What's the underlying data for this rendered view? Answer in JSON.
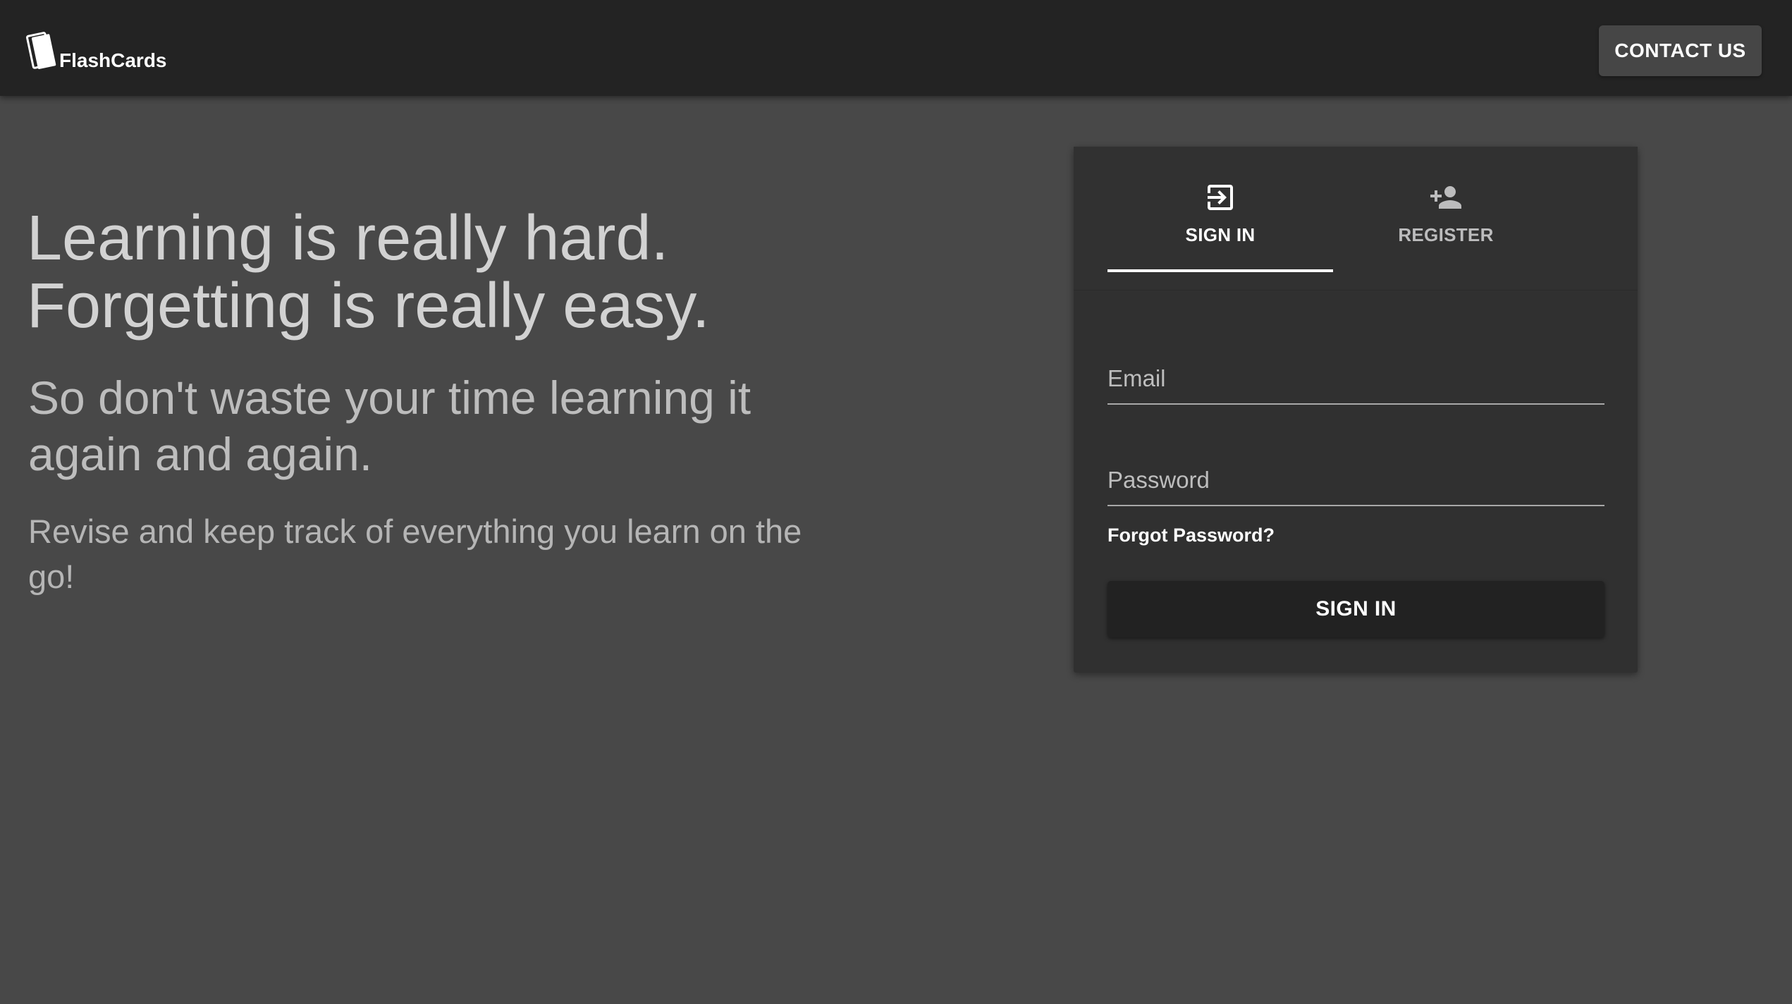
{
  "header": {
    "brand_name": "FlashCards",
    "brand_icon": "flashcard-logo-icon",
    "contact_label": "CONTACT US"
  },
  "hero": {
    "headline_line1": "Learning is really hard.",
    "headline_line2": "Forgetting is really easy.",
    "subheadline": "So don't waste your time learning it again and again.",
    "tagline": "Revise and keep track of everything you learn on the go!"
  },
  "auth": {
    "tabs": [
      {
        "label": "SIGN IN",
        "icon": "sign-in-icon",
        "selected": true
      },
      {
        "label": "REGISTER",
        "icon": "add-user-icon",
        "selected": false
      }
    ],
    "email": {
      "placeholder": "Email",
      "value": ""
    },
    "password": {
      "placeholder": "Password",
      "value": ""
    },
    "forgot_label": "Forgot Password?",
    "submit_label": "SIGN IN"
  },
  "colors": {
    "page_background": "#484848",
    "app_bar": "#232323",
    "card": "#303030",
    "primary_button": "#222222",
    "tab_indicator": "#ffffff"
  }
}
